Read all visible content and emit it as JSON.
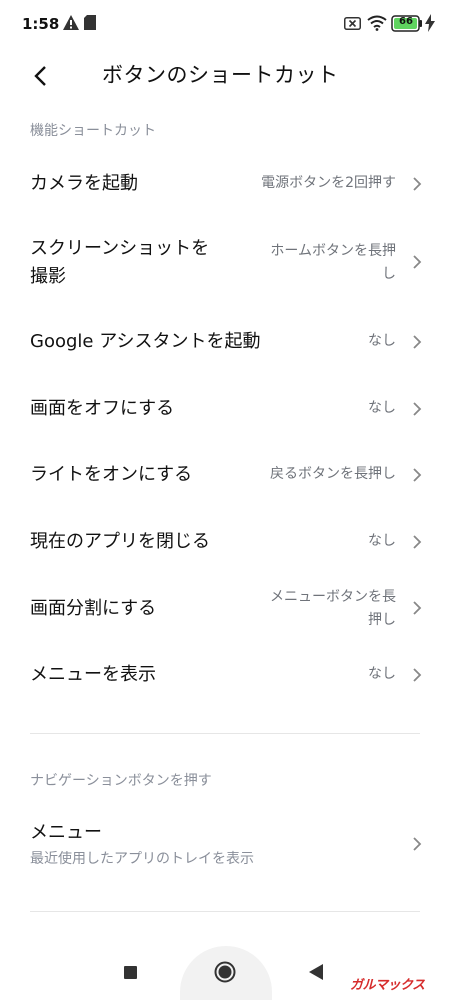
{
  "status_bar": {
    "time": "1:58",
    "battery": "66"
  },
  "header": {
    "title": "ボタンのショートカット"
  },
  "sections": {
    "functions": "機能ショートカット",
    "navigation": "ナビゲーションボタンを押す"
  },
  "shortcuts": [
    {
      "label": "カメラを起動",
      "value": "電源ボタンを2回押す"
    },
    {
      "label_line1": "スクリーンショットを",
      "label_line2": "撮影",
      "value_line1": "ホームボタンを長押",
      "value_line2": "し"
    },
    {
      "label": "Google アシスタントを起動",
      "value": "なし"
    },
    {
      "label": "画面をオフにする",
      "value": "なし"
    },
    {
      "label": "ライトをオンにする",
      "value": "戻るボタンを長押し"
    },
    {
      "label": "現在のアプリを閉じる",
      "value": "なし"
    },
    {
      "label": "画面分割にする",
      "value_line1": "メニューボタンを長",
      "value_line2": "押し"
    },
    {
      "label": "メニューを表示",
      "value": "なし"
    }
  ],
  "navigation_items": [
    {
      "label": "メニュー",
      "subtitle": "最近使用したアプリのトレイを表示"
    }
  ],
  "watermark": "ガルマックス",
  "colors": {
    "background": "#ffffff",
    "primary_text": "#111111",
    "secondary_text": "#6f737a",
    "section_header": "#8a8f9a",
    "watermark": "#d62c2c"
  }
}
